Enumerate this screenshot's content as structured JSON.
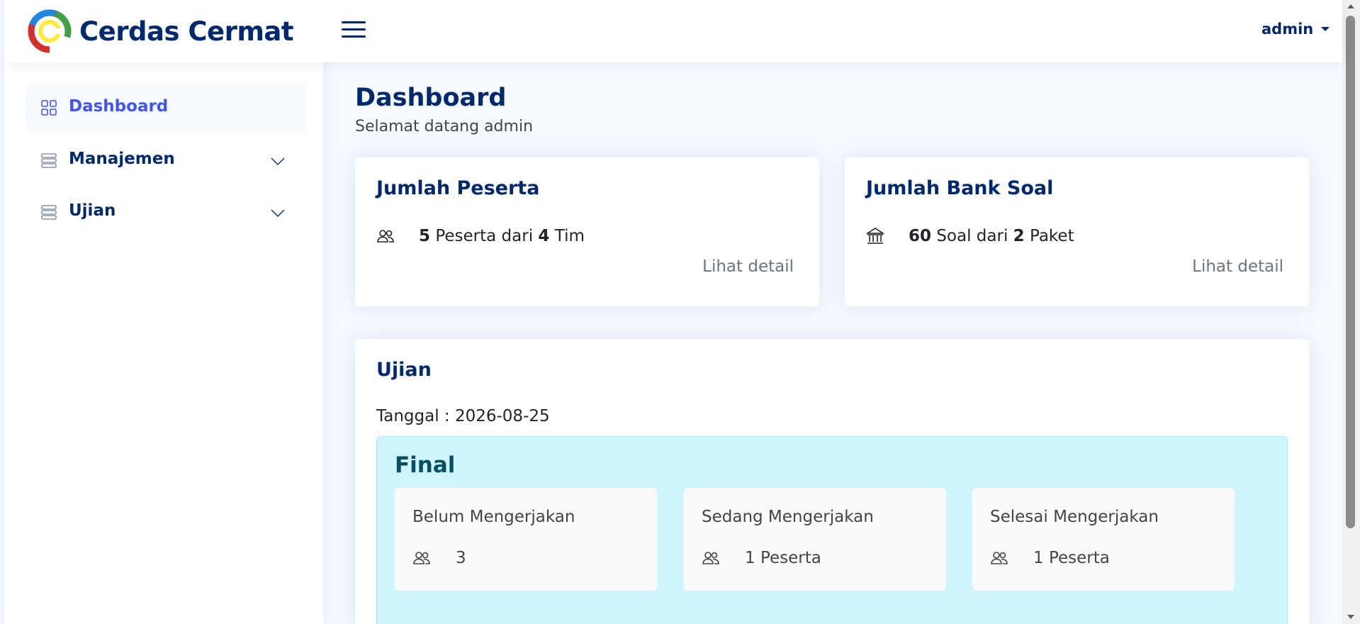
{
  "app": {
    "name": "Cerdas Cermat"
  },
  "header": {
    "user": "admin"
  },
  "sidebar": {
    "items": [
      {
        "label": "Dashboard",
        "icon": "grid-icon",
        "active": true
      },
      {
        "label": "Manajemen",
        "icon": "menu-list-icon",
        "expandable": true
      },
      {
        "label": "Ujian",
        "icon": "menu-list-icon",
        "expandable": true
      }
    ]
  },
  "page": {
    "title": "Dashboard",
    "subtitle": "Selamat datang admin"
  },
  "cards": {
    "peserta": {
      "title": "Jumlah Peserta",
      "count": "5",
      "count_label": "Peserta dari",
      "group_count": "4",
      "group_label": "Tim",
      "link": "Lihat detail",
      "icon": "people-icon"
    },
    "bank_soal": {
      "title": "Jumlah Bank Soal",
      "count": "60",
      "count_label": "Soal dari",
      "group_count": "2",
      "group_label": "Paket",
      "link": "Lihat detail",
      "icon": "bank-icon"
    }
  },
  "ujian": {
    "title": "Ujian",
    "date_line": "Tanggal : 2026-08-25",
    "session": {
      "name": "Final",
      "statuses": [
        {
          "label": "Belum Mengerjakan",
          "value": "3"
        },
        {
          "label": "Sedang Mengerjakan",
          "value": "1 Peserta"
        },
        {
          "label": "Selesai Mengerjakan",
          "value": "1 Peserta"
        }
      ]
    }
  },
  "colors": {
    "primary": "#012970",
    "accent": "#4154f1",
    "background": "#f6f9ff",
    "info_panel": "#cff4fc",
    "info_text": "#055160",
    "muted": "#6c757d"
  }
}
